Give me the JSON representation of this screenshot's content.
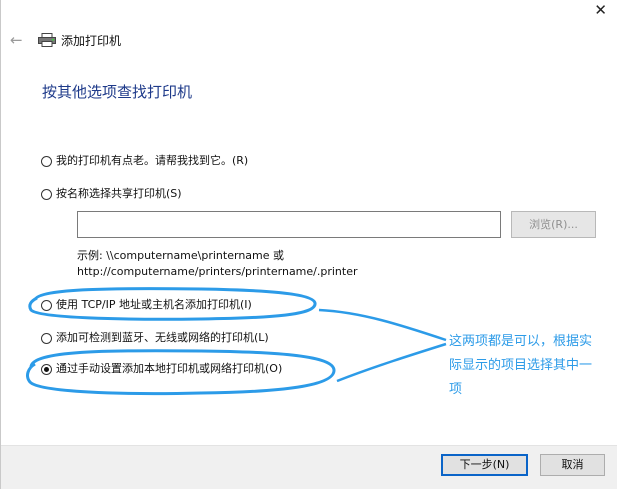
{
  "window": {
    "title": "添加打印机",
    "close_label": "✕",
    "back_label": "←"
  },
  "page": {
    "heading": "按其他选项查找打印机"
  },
  "options": [
    {
      "label": "我的打印机有点老。请帮我找到它。(R)",
      "selected": false
    },
    {
      "label": "按名称选择共享打印机(S)",
      "selected": false
    },
    {
      "label": "使用 TCP/IP 地址或主机名添加打印机(I)",
      "selected": false
    },
    {
      "label": "添加可检测到蓝牙、无线或网络的打印机(L)",
      "selected": false
    },
    {
      "label": "通过手动设置添加本地打印机或网络打印机(O)",
      "selected": true
    }
  ],
  "shared_printer": {
    "input_value": "",
    "browse_label": "浏览(R)...",
    "example_line1": "示例: \\\\computername\\printername 或",
    "example_line2": "http://computername/printers/printername/.printer"
  },
  "annotation": {
    "text": "这两项都是可以，根据实际显示的项目选择其中一项",
    "color": "#2c9be8"
  },
  "footer": {
    "next_label": "下一步(N)",
    "cancel_label": "取消"
  },
  "colors": {
    "heading": "#1e3a8a",
    "accent": "#0a64c8"
  }
}
